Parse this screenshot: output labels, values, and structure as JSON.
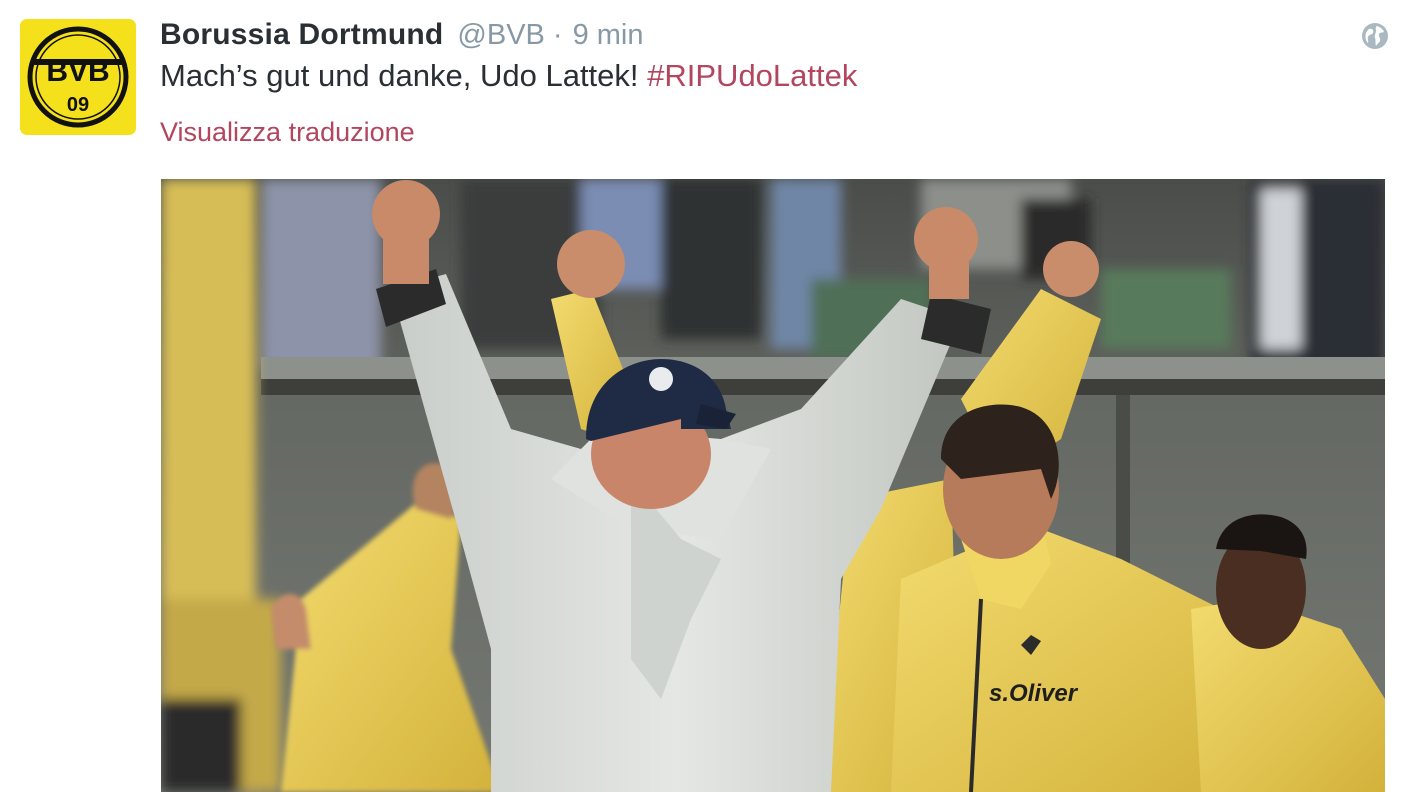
{
  "tweet": {
    "display_name": "Borussia Dortmund",
    "handle": "@BVB",
    "separator": "·",
    "time": "9 min",
    "text_main": "Mach’s gut und danke, Udo Lattek! ",
    "hashtag": "#RIPUdoLattek",
    "translate_label": "Visualizza traduzione"
  },
  "avatar": {
    "logo_letters": "BVB",
    "logo_year": "09",
    "colors": {
      "background": "#f5e01c",
      "ring": "#111111"
    }
  },
  "photo": {
    "jacket_text": "s.Oliver"
  },
  "icons": {
    "globe": "globe-icon"
  },
  "colors": {
    "name": "#292f33",
    "meta": "#8899a6",
    "link": "#b2465e",
    "yellow": "#e9c84a"
  }
}
